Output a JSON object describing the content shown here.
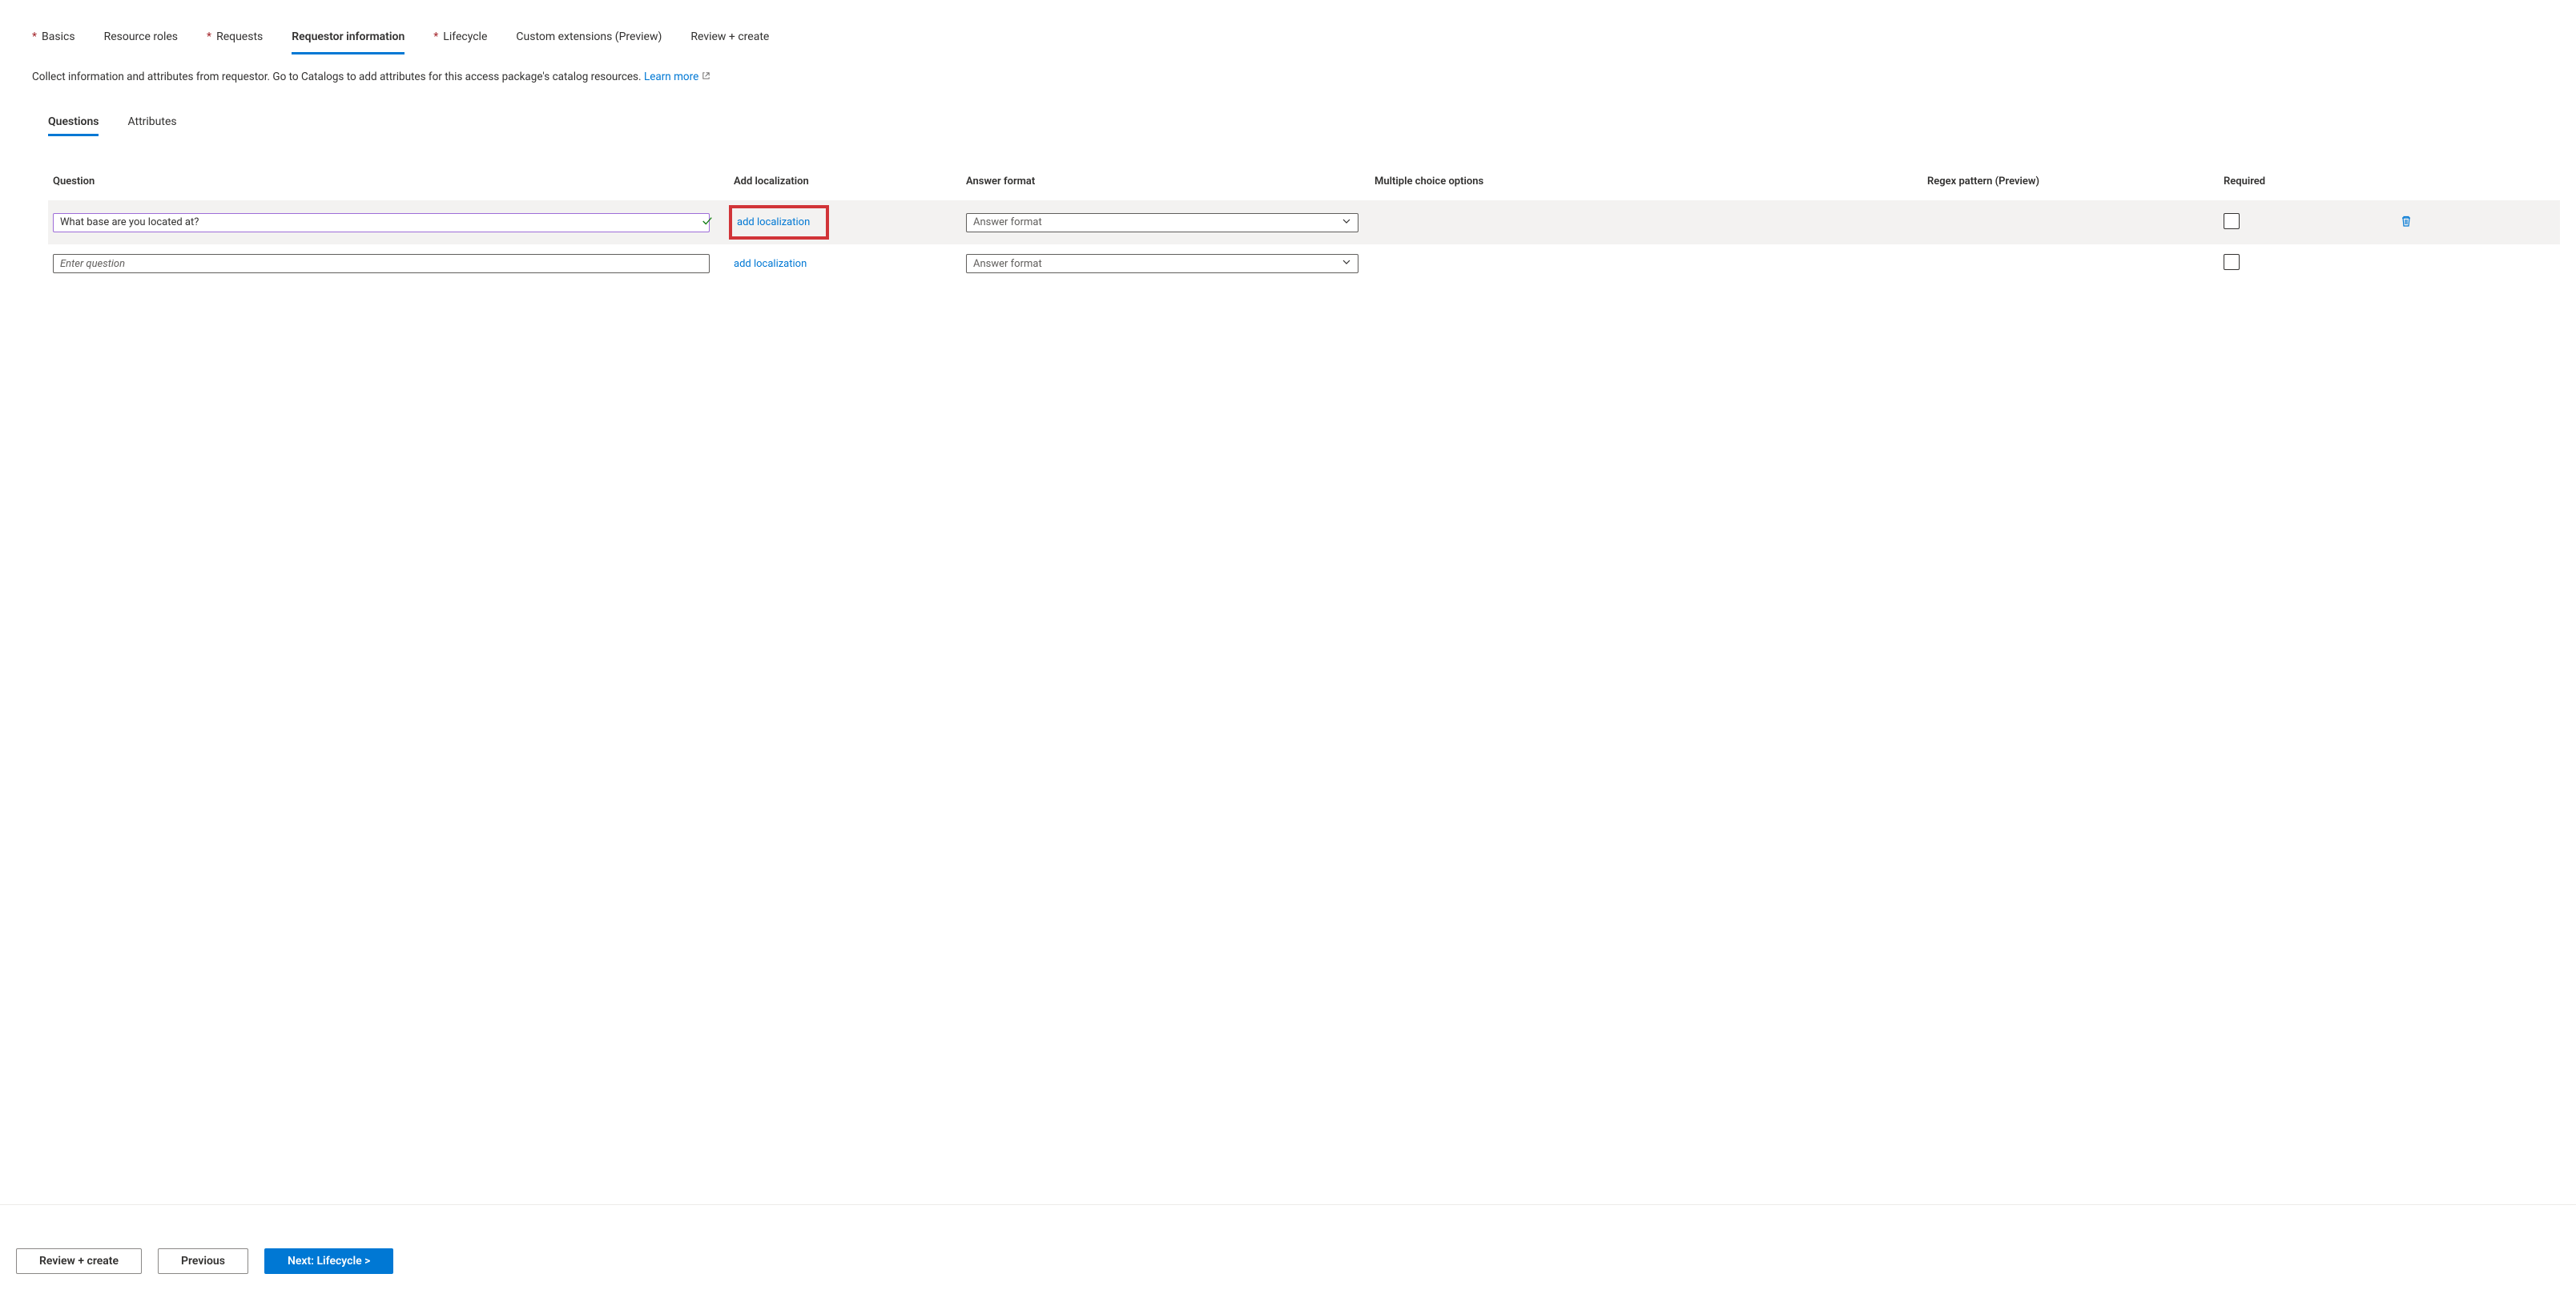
{
  "topTabs": {
    "basics": {
      "label": "Basics",
      "required": true
    },
    "roles": {
      "label": "Resource roles",
      "required": false
    },
    "requests": {
      "label": "Requests",
      "required": true
    },
    "reqinfo": {
      "label": "Requestor information",
      "required": false,
      "active": true
    },
    "lifecycle": {
      "label": "Lifecycle",
      "required": true
    },
    "custext": {
      "label": "Custom extensions (Preview)",
      "required": false
    },
    "review": {
      "label": "Review + create",
      "required": false
    }
  },
  "description": {
    "text": "Collect information and attributes from requestor. Go to Catalogs to add attributes for this access package's catalog resources.",
    "learnMore": "Learn more"
  },
  "subTabs": {
    "questions": {
      "label": "Questions",
      "active": true
    },
    "attributes": {
      "label": "Attributes"
    }
  },
  "columns": {
    "question": "Question",
    "addloc": "Add localization",
    "format": "Answer format",
    "mco": "Multiple choice options",
    "regex": "Regex pattern (Preview)",
    "required": "Required"
  },
  "rows": [
    {
      "question_value": "What base are you located at?",
      "question_placeholder": "",
      "valid": true,
      "addloc_label": "add localization",
      "format_placeholder": "Answer format",
      "highlight_loc": true,
      "show_delete": true
    },
    {
      "question_value": "",
      "question_placeholder": "Enter question",
      "valid": false,
      "addloc_label": "add localization",
      "format_placeholder": "Answer format",
      "highlight_loc": false,
      "show_delete": false
    }
  ],
  "footer": {
    "review": "Review + create",
    "previous": "Previous",
    "next": "Next: Lifecycle >"
  }
}
